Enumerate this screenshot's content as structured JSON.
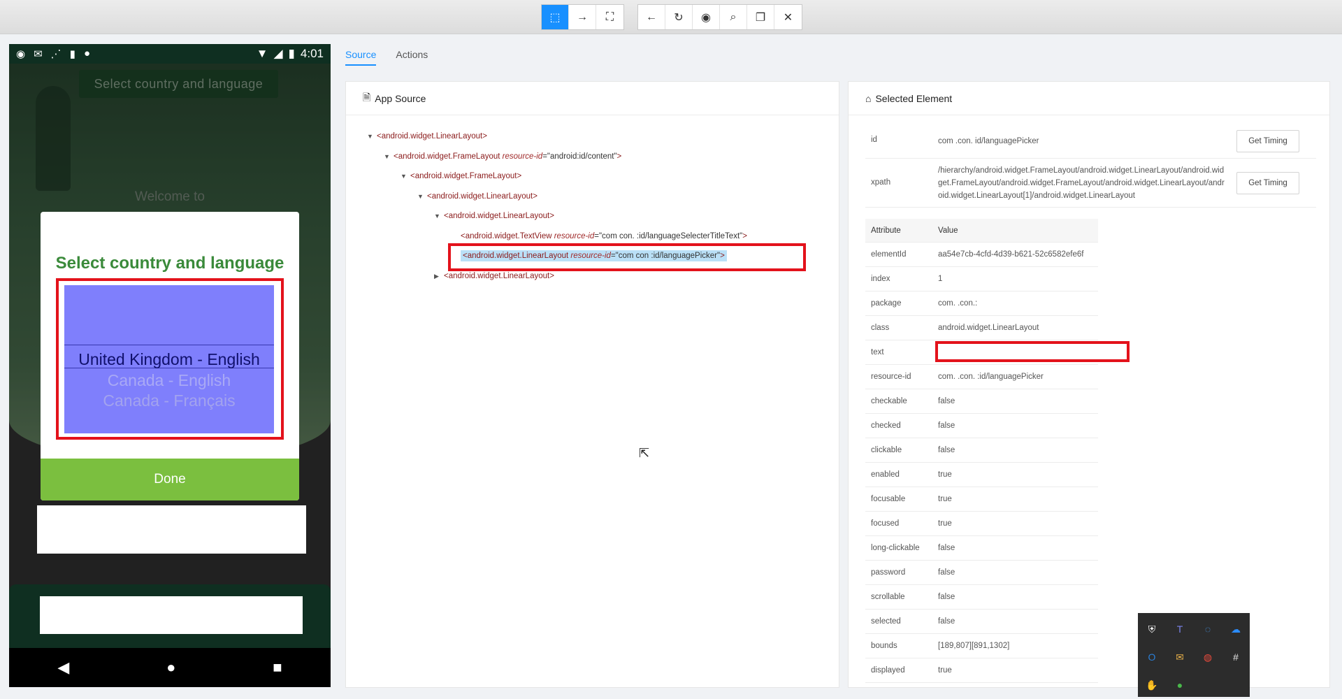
{
  "toolbar": {
    "group1": [
      {
        "name": "select-elements-icon",
        "glyph": "⬚",
        "active": true
      },
      {
        "name": "swipe-icon",
        "glyph": "→"
      },
      {
        "name": "tap-coordinates-icon",
        "glyph": "⛶"
      }
    ],
    "group2": [
      {
        "name": "back-icon",
        "glyph": "←"
      },
      {
        "name": "refresh-icon",
        "glyph": "↻"
      },
      {
        "name": "eye-icon",
        "glyph": "◉"
      },
      {
        "name": "search-icon",
        "glyph": "⌕"
      },
      {
        "name": "copy-icon",
        "glyph": "❐"
      },
      {
        "name": "close-icon",
        "glyph": "✕"
      }
    ]
  },
  "device": {
    "time": "4:01",
    "top_button": "Select country and language",
    "welcome": "Welcome to",
    "dialog_title": "Select country and language",
    "picker": {
      "selected": "United Kingdom - English",
      "option1": "Canada - English",
      "option2": "Canada - Français"
    },
    "done": "Done"
  },
  "tabs": {
    "source": "Source",
    "actions": "Actions"
  },
  "app_source": {
    "title": "App Source",
    "nodes": [
      {
        "tag": "<android.widget.LinearLayout>",
        "attr": "",
        "val": "",
        "close": "",
        "arrow": "▼"
      },
      {
        "tag": "<android.widget.FrameLayout ",
        "attr": "resource-id",
        "val": "=\"android:id/content\"",
        "close": ">",
        "arrow": "▼"
      },
      {
        "tag": "<android.widget.FrameLayout>",
        "attr": "",
        "val": "",
        "close": "",
        "arrow": "▼"
      },
      {
        "tag": "<android.widget.LinearLayout>",
        "attr": "",
        "val": "",
        "close": "",
        "arrow": "▼"
      },
      {
        "tag": "<android.widget.LinearLayout>",
        "attr": "",
        "val": "",
        "close": "",
        "arrow": "▼"
      },
      {
        "tag": "<android.widget.TextView ",
        "attr": "resource-id",
        "val": "=\"com      con.             :id/languageSelecterTitleText\"",
        "close": ">",
        "arrow": ""
      },
      {
        "tag": "<android.widget.LinearLayout ",
        "attr": "resource-id",
        "val": "=\"com       con              :id/languagePicker\"",
        "close": ">",
        "arrow": ""
      },
      {
        "tag": "<android.widget.LinearLayout>",
        "attr": "",
        "val": "",
        "close": "",
        "arrow": "▶"
      }
    ]
  },
  "selected_element": {
    "title": "Selected Element",
    "id_label": "id",
    "id_value": "com      .con.          id/languagePicker",
    "xpath_label": "xpath",
    "xpath_value": "/hierarchy/android.widget.FrameLayout/android.widget.LinearLayout/android.widget.FrameLayout/android.widget.FrameLayout/android.widget.LinearLayout/android.widget.LinearLayout[1]/android.widget.LinearLayout",
    "get_timing": "Get Timing",
    "attr_header": "Attribute",
    "value_header": "Value",
    "attributes": [
      {
        "k": "elementId",
        "v": "aa54e7cb-4cfd-4d39-b621-52c6582efe6f"
      },
      {
        "k": "index",
        "v": "1"
      },
      {
        "k": "package",
        "v": "com.    .con.:"
      },
      {
        "k": "class",
        "v": "android.widget.LinearLayout"
      },
      {
        "k": "text",
        "v": ""
      },
      {
        "k": "resource-id",
        "v": "com.     .con.             :id/languagePicker"
      },
      {
        "k": "checkable",
        "v": "false"
      },
      {
        "k": "checked",
        "v": "false"
      },
      {
        "k": "clickable",
        "v": "false"
      },
      {
        "k": "enabled",
        "v": "true"
      },
      {
        "k": "focusable",
        "v": "true"
      },
      {
        "k": "focused",
        "v": "true"
      },
      {
        "k": "long-clickable",
        "v": "false"
      },
      {
        "k": "password",
        "v": "false"
      },
      {
        "k": "scrollable",
        "v": "false"
      },
      {
        "k": "selected",
        "v": "false"
      },
      {
        "k": "bounds",
        "v": "[189,807][891,1302]"
      },
      {
        "k": "displayed",
        "v": "true"
      }
    ]
  },
  "tray_icons": [
    {
      "name": "shield-icon",
      "glyph": "⛨",
      "color": "#ffffff"
    },
    {
      "name": "teams-icon",
      "glyph": "T",
      "color": "#7b83eb"
    },
    {
      "name": "sync-icon",
      "glyph": "◌",
      "color": "#4aa3ff"
    },
    {
      "name": "onedrive-icon",
      "glyph": "☁",
      "color": "#2b8cff"
    },
    {
      "name": "outlook-icon",
      "glyph": "O",
      "color": "#2b7fd6"
    },
    {
      "name": "mail-icon",
      "glyph": "✉",
      "color": "#e8b04a"
    },
    {
      "name": "chrome-icon",
      "glyph": "◍",
      "color": "#e84a3c"
    },
    {
      "name": "slack-icon",
      "glyph": "#",
      "color": "#e0e0e0"
    },
    {
      "name": "hand-icon",
      "glyph": "✋",
      "color": "#e0e0e0"
    },
    {
      "name": "vpn-icon",
      "glyph": "●",
      "color": "#49b84a"
    }
  ]
}
